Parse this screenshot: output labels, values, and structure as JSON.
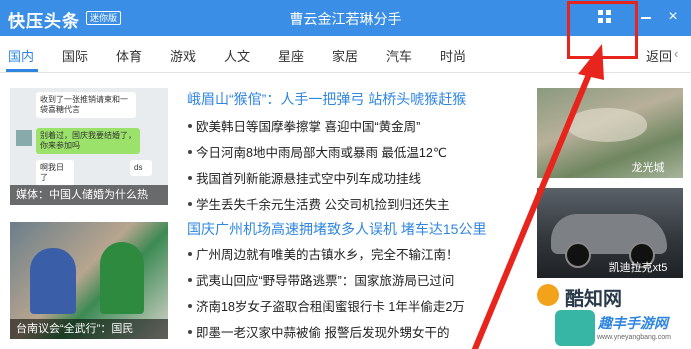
{
  "window": {
    "app_name": "快压头条",
    "badge": "迷你版",
    "headline": "曹云金江若琳分手",
    "close_glyph": "×"
  },
  "nav": {
    "tabs": [
      "国内",
      "国际",
      "体育",
      "游戏",
      "人文",
      "星座",
      "家居",
      "汽车",
      "时尚"
    ],
    "active": "国内",
    "back_label": "返回",
    "back_arrow": "‹"
  },
  "left_images": [
    {
      "caption": "媒体：中国人储婚为什么热",
      "chat": [
        "收到了一张推销请柬和一袋喜糖代言",
        "别着过，国庆我要结婚了，你来参加吗",
        "啊我日了",
        "ds"
      ]
    },
    {
      "caption": "台南议会“全武行”：国民"
    }
  ],
  "sections": [
    {
      "title": "峨眉山“猴倌”：人手一把弹弓 站桥头唬猴赶猴",
      "items": [
        "欧美韩日等国摩拳擦掌 喜迎中国“黄金周”",
        "今日河南8地中雨局部大雨或暴雨 最低温12℃",
        "我国首列新能源悬挂式空中列车成功挂线",
        "学生丢失千余元生活费 公交司机捡到归还失主"
      ]
    },
    {
      "title": "国庆广州机场高速拥堵致多人误机 堵车达15公里",
      "items": [
        "广州周边就有唯美的古镇水乡，完全不输江南！",
        "武夷山回应“野导带路逃票”：国家旅游局已过问",
        "济南18岁女子盗取合租闺蜜银行卡 1年半偷走2万",
        "即墨一老汉家中蒜被偷 报警后发现外甥女干的"
      ]
    }
  ],
  "right_images": [
    {
      "caption": "龙光城"
    },
    {
      "caption": "凯迪拉克xt5"
    }
  ],
  "watermark": {
    "brand": "酷知网",
    "site_name": "趣丰手游网",
    "site_url": "www.yneyangbang.com"
  },
  "colors": {
    "titlebar": "#3a8ee6",
    "accent": "#2f86e0",
    "annotation": "#e8251c"
  }
}
